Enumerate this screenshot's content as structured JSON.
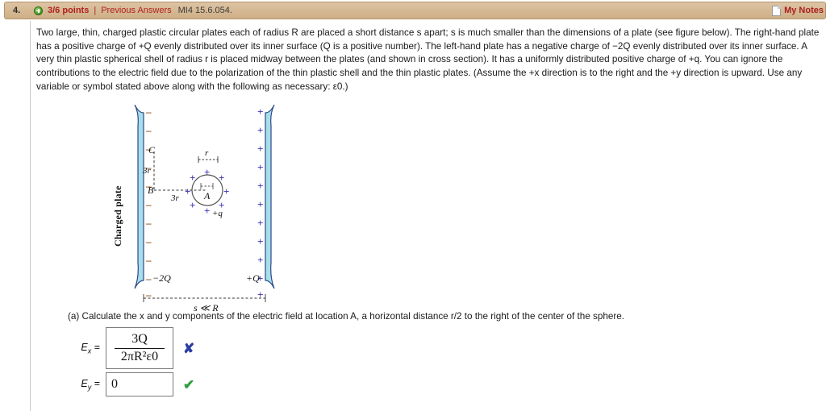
{
  "header": {
    "question_number": "4.",
    "status_icon": "plus-circle-icon",
    "points": "3/6 points",
    "separator": "|",
    "previous_answers": "Previous Answers",
    "question_code": "MI4 15.6.054.",
    "notes_icon": "page-icon",
    "notes_label": "My Notes"
  },
  "question": {
    "text": "Two large, thin, charged plastic circular plates each of radius R are placed a short distance s apart; s is much smaller than the dimensions of a plate (see figure below). The right-hand plate has a positive charge of +Q evenly distributed over its inner surface (Q is a positive number). The left-hand plate has a negative charge of −2Q evenly distributed over its inner surface. A very thin plastic spherical shell of radius r is placed midway between the plates (and shown in cross section). It has a uniformly distributed positive charge of +q. You can ignore the contributions to the electric field due to the polarization of the thin plastic shell and the thin plastic plates. (Assume the +x direction is to the right and the +y direction is upward. Use any variable or symbol stated above along with the following as necessary: ε0.)"
  },
  "figure": {
    "vertical_label": "Charged plate",
    "left_plate_charge": "−2Q",
    "right_plate_charge": "+Q",
    "left_plate_sign": "−",
    "right_plate_sign": "+",
    "point_c": "C",
    "point_b": "B",
    "point_a": "A",
    "dim_vertical": "3r",
    "dim_horizontal": "3r",
    "sphere_radius_label": "r",
    "sphere_charge": "+q",
    "gap_label": "s ≪ R",
    "plate_fill_color": "#a8ddea",
    "plate_outline_color": "#2b4a8a",
    "minus_color": "#8a4a10",
    "plus_color": "#3a35b8"
  },
  "part_a": {
    "prompt": "(a) Calculate the x and y components of the electric field at location A, a horizontal distance r/2 to the right of the center of the sphere.",
    "answers": [
      {
        "label": "Ex",
        "label_base": "E",
        "label_sub": "x",
        "value_numerator": "3Q",
        "value_denominator": "2πR²ε0",
        "is_fraction": true,
        "mark": "✘",
        "mark_state": "incorrect",
        "mark_color": "#2b3fa0"
      },
      {
        "label": "Ey",
        "label_base": "E",
        "label_sub": "y",
        "value": "0",
        "is_fraction": false,
        "mark": "✔",
        "mark_state": "correct",
        "mark_color": "#2f9e3f"
      }
    ]
  }
}
